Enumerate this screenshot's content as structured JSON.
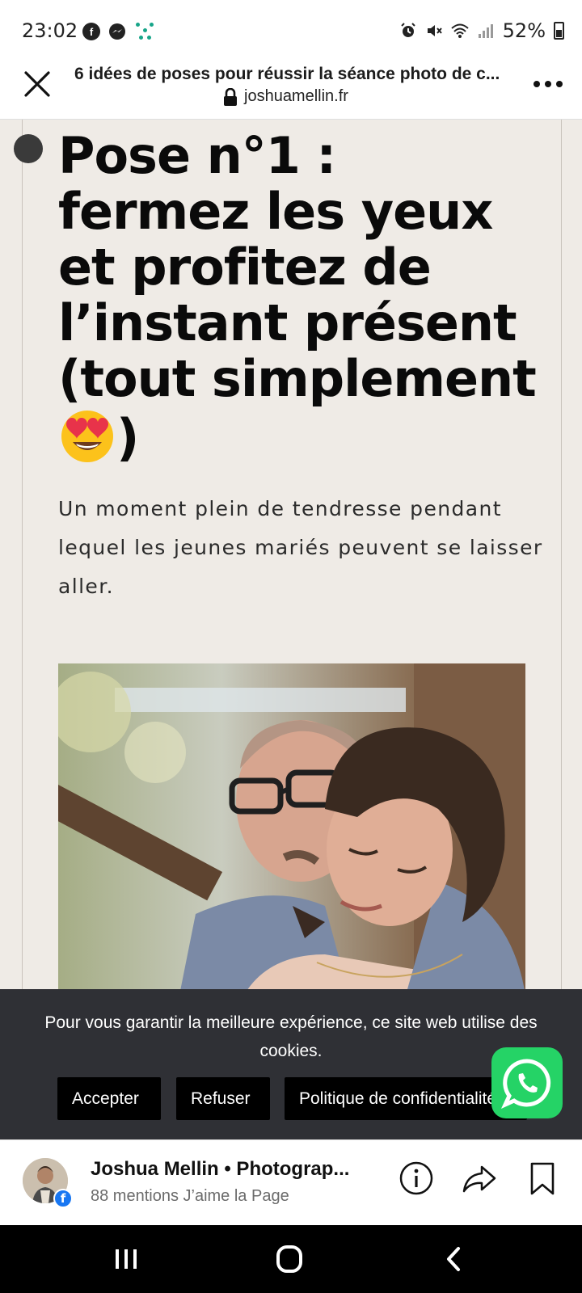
{
  "status_bar": {
    "time": "23:02",
    "battery": "52%",
    "icons": [
      "facebook-icon",
      "messenger-icon",
      "dots-icon",
      "alarm-icon",
      "mute-icon",
      "wifi-icon",
      "signal-icon",
      "battery-icon"
    ]
  },
  "browser": {
    "page_title": "6 idées de poses pour réussir la séance photo de c...",
    "url": "joshuamellin.fr"
  },
  "article": {
    "title": "Pose n°1 : fermez les yeux et profitez de l’instant présent (tout simplement",
    "title_end": ")",
    "lead": "Un moment plein de tendresse pendant lequel les jeunes mariés peuvent se laisser aller."
  },
  "cookie_banner": {
    "text": "Pour vous garantir la meilleure expérience, ce site web utilise des cookies.",
    "accept": "Accepter",
    "refuse": "Refuser",
    "policy": "Politique de confidentialité"
  },
  "facebook_page": {
    "name": "Joshua Mellin • Photograp...",
    "likes": "88 mentions J’aime la Page"
  },
  "colors": {
    "page_background": "#efebe6",
    "cookie_background": "#2f3035",
    "whatsapp": "#25d366",
    "facebook_blue": "#1877f2"
  }
}
